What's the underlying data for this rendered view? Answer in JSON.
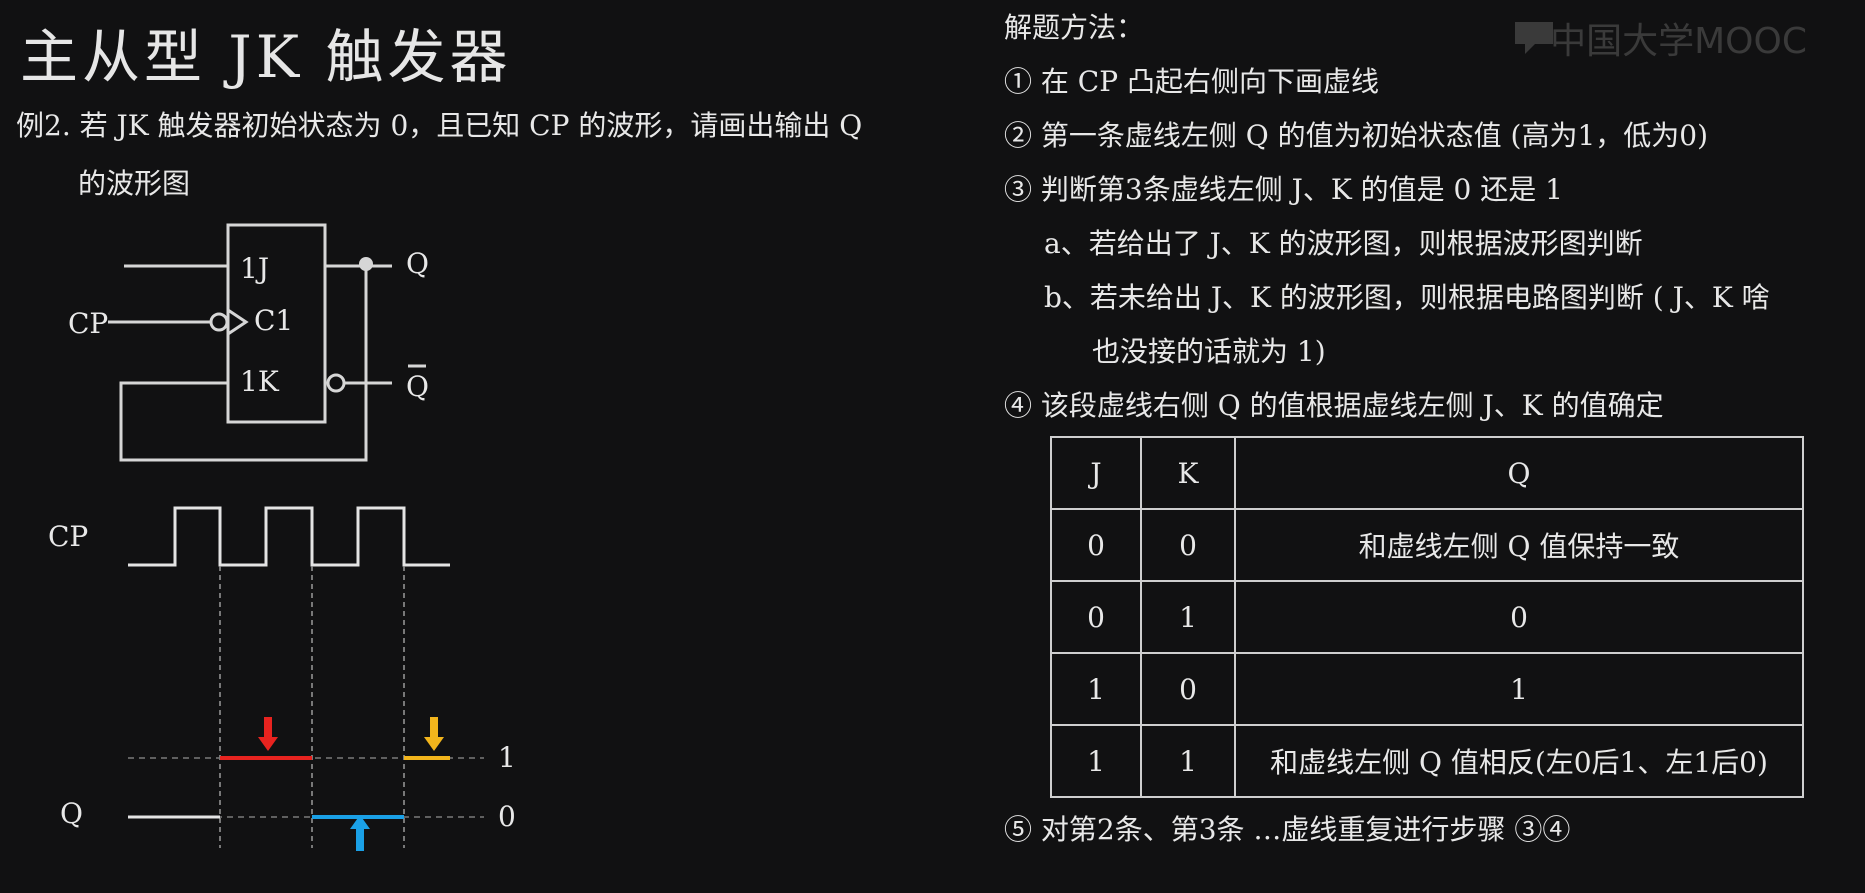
{
  "title": "主从型 JK 触发器",
  "example": {
    "line1": "例2. 若 JK 触发器初始状态为 0，且已知 CP 的波形，请画出输出 Q",
    "line2": "的波形图"
  },
  "circuit": {
    "pin_1j": "1J",
    "pin_c1": "C1",
    "pin_1k": "1K",
    "input_cp": "CP",
    "output_q": "Q",
    "output_qbar": "Q"
  },
  "waveform": {
    "cp_label": "CP",
    "q_label": "Q",
    "level_high": "1",
    "level_low": "0",
    "colors": {
      "red": "#e8231f",
      "yellow": "#f2b51c",
      "blue": "#1aa0e6"
    }
  },
  "method": {
    "heading": "解题方法：",
    "step1": "① 在 CP 凸起右侧向下画虚线",
    "step2": "② 第一条虚线左侧 Q 的值为初始状态值 (高为1，低为0)",
    "step3": "③ 判断第3条虚线左侧 J、K 的值是 0 还是 1",
    "step3a": "a、若给出了 J、K 的波形图，则根据波形图判断",
    "step3b_line1": "b、若未给出 J、K 的波形图，则根据电路图判断 ( J、K 啥",
    "step3b_line2": "也没接的话就为 1)",
    "step4": "④ 该段虚线右侧 Q 的值根据虚线左侧 J、K 的值确定",
    "step5": "⑤ 对第2条、第3条 …虚线重复进行步骤 ③④"
  },
  "truth_table": {
    "headers": [
      "J",
      "K",
      "Q"
    ],
    "rows": [
      [
        "0",
        "0",
        "和虚线左侧 Q 值保持一致"
      ],
      [
        "0",
        "1",
        "0"
      ],
      [
        "1",
        "0",
        "1"
      ],
      [
        "1",
        "1",
        "和虚线左侧 Q 值相反(左0后1、左1后0)"
      ]
    ]
  },
  "watermark": "中国大学MOOC"
}
